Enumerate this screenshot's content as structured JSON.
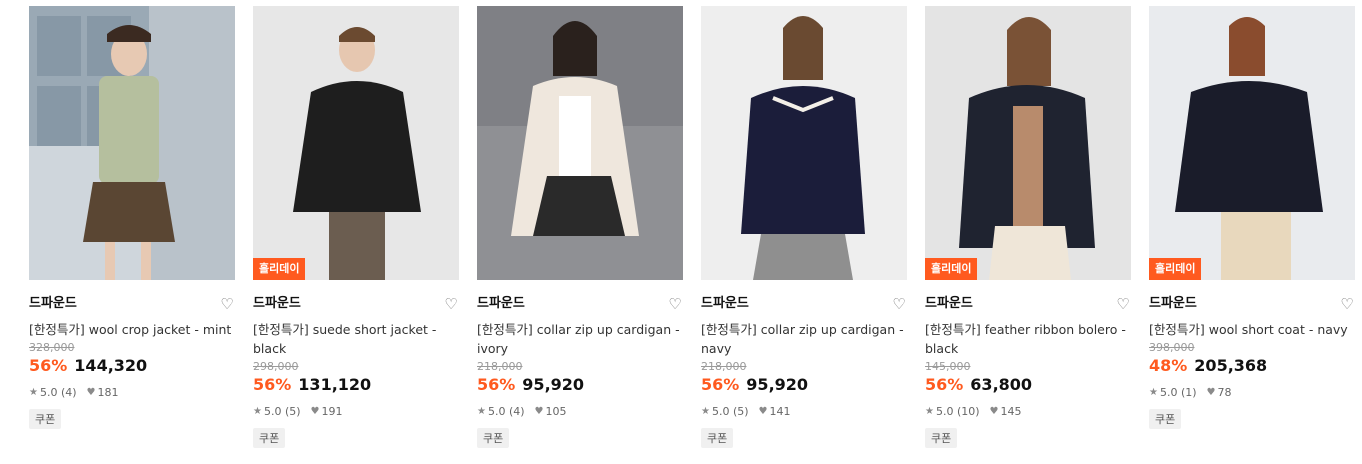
{
  "products": [
    {
      "brand": "드파운드",
      "name": "[한정특가] wool crop jacket - mint",
      "original_price": "328,000",
      "discount": "56%",
      "price": "144,320",
      "rating": "5.0 (4)",
      "likes": "181",
      "coupon": "쿠폰",
      "badge": ""
    },
    {
      "brand": "드파운드",
      "name": "[한정특가] suede short jacket - black",
      "original_price": "298,000",
      "discount": "56%",
      "price": "131,120",
      "rating": "5.0 (5)",
      "likes": "191",
      "coupon": "쿠폰",
      "badge": "홀리데이"
    },
    {
      "brand": "드파운드",
      "name": "[한정특가] collar zip up cardigan - ivory",
      "original_price": "218,000",
      "discount": "56%",
      "price": "95,920",
      "rating": "5.0 (4)",
      "likes": "105",
      "coupon": "쿠폰",
      "badge": ""
    },
    {
      "brand": "드파운드",
      "name": "[한정특가] collar zip up cardigan - navy",
      "original_price": "218,000",
      "discount": "56%",
      "price": "95,920",
      "rating": "5.0 (5)",
      "likes": "141",
      "coupon": "쿠폰",
      "badge": ""
    },
    {
      "brand": "드파운드",
      "name": "[한정특가] feather ribbon bolero - black",
      "original_price": "145,000",
      "discount": "56%",
      "price": "63,800",
      "rating": "5.0 (10)",
      "likes": "145",
      "coupon": "쿠폰",
      "badge": "홀리데이"
    },
    {
      "brand": "드파운드",
      "name": "[한정특가] wool short coat - navy",
      "original_price": "398,000",
      "discount": "48%",
      "price": "205,368",
      "rating": "5.0 (1)",
      "likes": "78",
      "coupon": "쿠폰",
      "badge": "홀리데이"
    }
  ],
  "colors": {
    "accent": "#ff5a1f",
    "strike": "#9a9a9a",
    "coupon_bg": "#f0f0f0"
  },
  "icons": {
    "heart_outline": "heart-outline-icon",
    "star": "star-icon",
    "heart_small": "heart-small-icon"
  }
}
